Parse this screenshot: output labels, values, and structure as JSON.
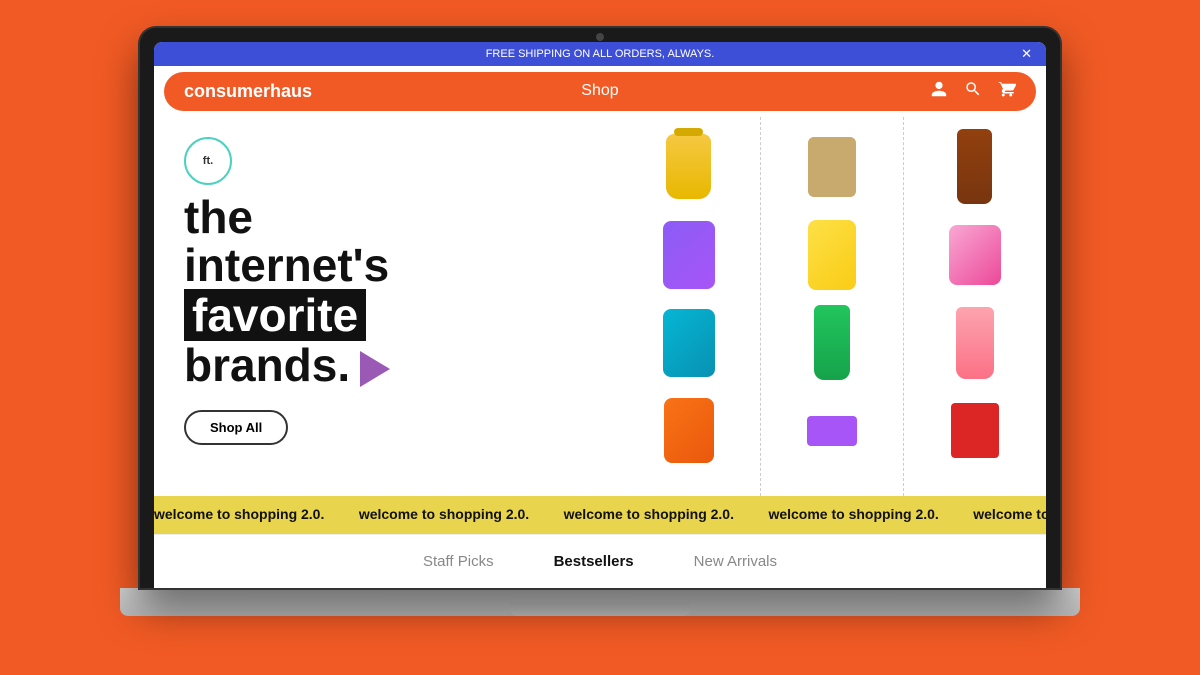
{
  "announcement": {
    "text": "FREE SHIPPING ON ALL ORDERS, ALWAYS.",
    "close_label": "✕"
  },
  "header": {
    "logo": "consumerhaus",
    "nav_label": "Shop",
    "icons": {
      "account": "👤",
      "search": "🔍",
      "cart": "🛒"
    }
  },
  "hero": {
    "badge": "ft.",
    "line1": "the",
    "line2": "internet's",
    "line3_plain": "fav",
    "line3_highlight": "orite",
    "line4": "brands.",
    "shop_all_label": "Shop All"
  },
  "banner": {
    "text": "welcome to shopping 2.0.",
    "repeat_count": 10
  },
  "tabs": [
    {
      "label": "Staff Picks",
      "active": false
    },
    {
      "label": "Bestsellers",
      "active": true
    },
    {
      "label": "New Arrivals",
      "active": false
    }
  ],
  "colors": {
    "orange": "#F15A24",
    "blue": "#3d4fd6",
    "yellow": "#e8d44d"
  }
}
